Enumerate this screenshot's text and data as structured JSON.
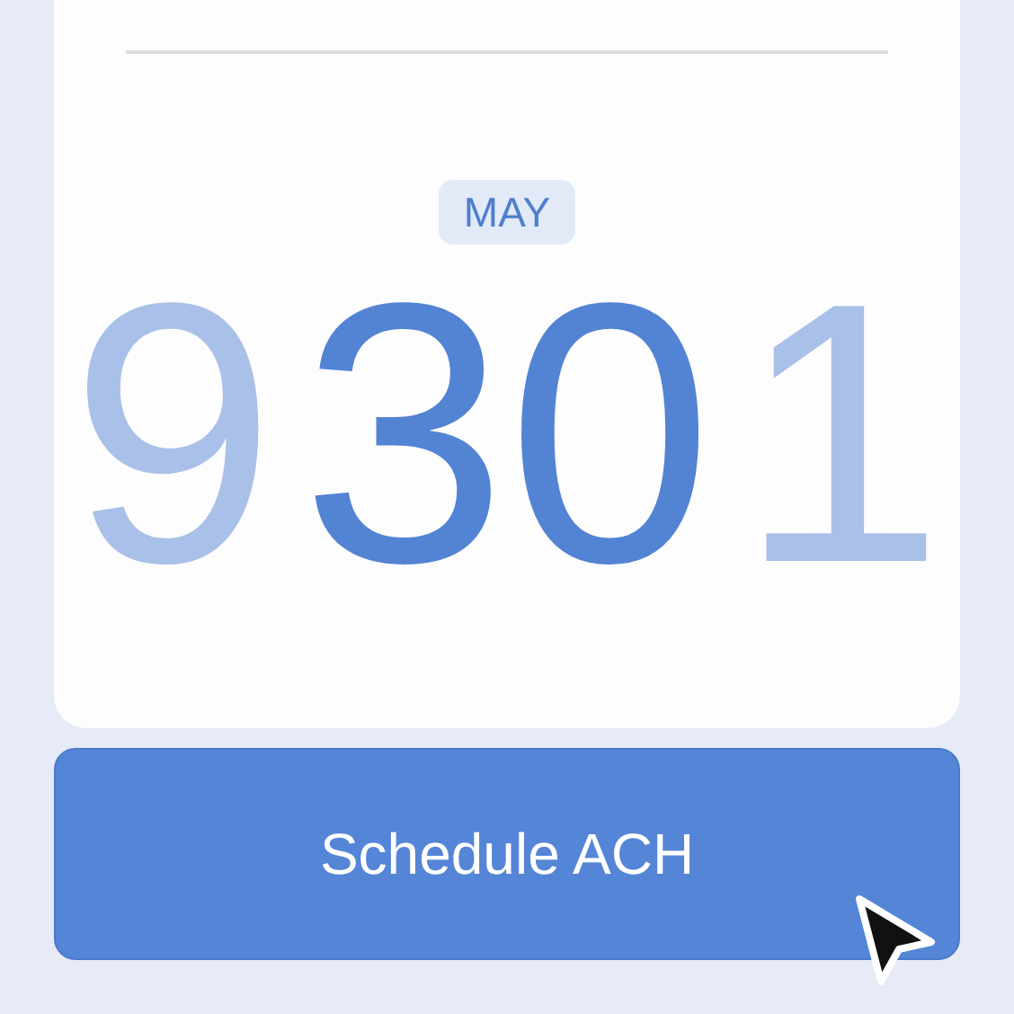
{
  "month": "MAY",
  "days": [
    {
      "label": "9",
      "selected": false
    },
    {
      "label": "30",
      "selected": true
    },
    {
      "label": "1",
      "selected": false
    }
  ],
  "button": {
    "label": "Schedule ACH"
  }
}
